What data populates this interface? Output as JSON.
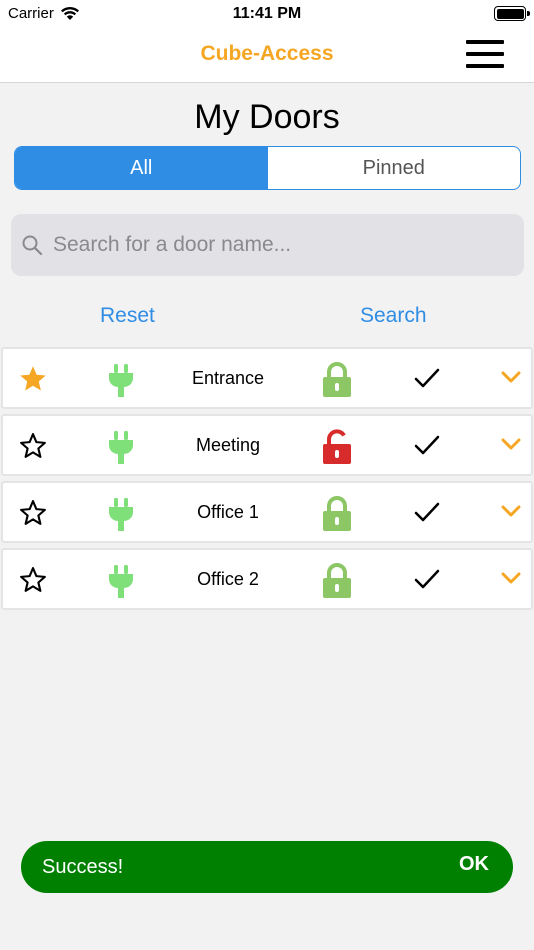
{
  "status_bar": {
    "carrier": "Carrier",
    "time": "11:41 PM",
    "icons": [
      "wifi-icon",
      "battery-icon"
    ]
  },
  "nav": {
    "title": "Cube-Access",
    "menu_icon": "hamburger-menu-icon"
  },
  "page": {
    "title": "My Doors"
  },
  "segment": {
    "tabs": [
      {
        "label": "All",
        "selected": true
      },
      {
        "label": "Pinned",
        "selected": false
      }
    ]
  },
  "search": {
    "placeholder": "Search for a door name...",
    "value": ""
  },
  "actions": {
    "reset_label": "Reset",
    "search_label": "Search"
  },
  "doors": [
    {
      "name": "Entrance",
      "pinned": true,
      "powered": true,
      "lock_state": "locked",
      "status_ok": true
    },
    {
      "name": "Meeting",
      "pinned": false,
      "powered": true,
      "lock_state": "unlocked",
      "status_ok": true
    },
    {
      "name": "Office 1",
      "pinned": false,
      "powered": true,
      "lock_state": "locked",
      "status_ok": true
    },
    {
      "name": "Office 2",
      "pinned": false,
      "powered": true,
      "lock_state": "locked",
      "status_ok": true
    }
  ],
  "toast": {
    "message": "Success!",
    "action_label": "OK"
  },
  "colors": {
    "accent_orange": "#f5a623",
    "accent_blue": "#2f8de4",
    "plug_green": "#7fe07a",
    "lock_green": "#8cc665",
    "lock_red": "#d82c2c",
    "toast_green": "#008000"
  }
}
